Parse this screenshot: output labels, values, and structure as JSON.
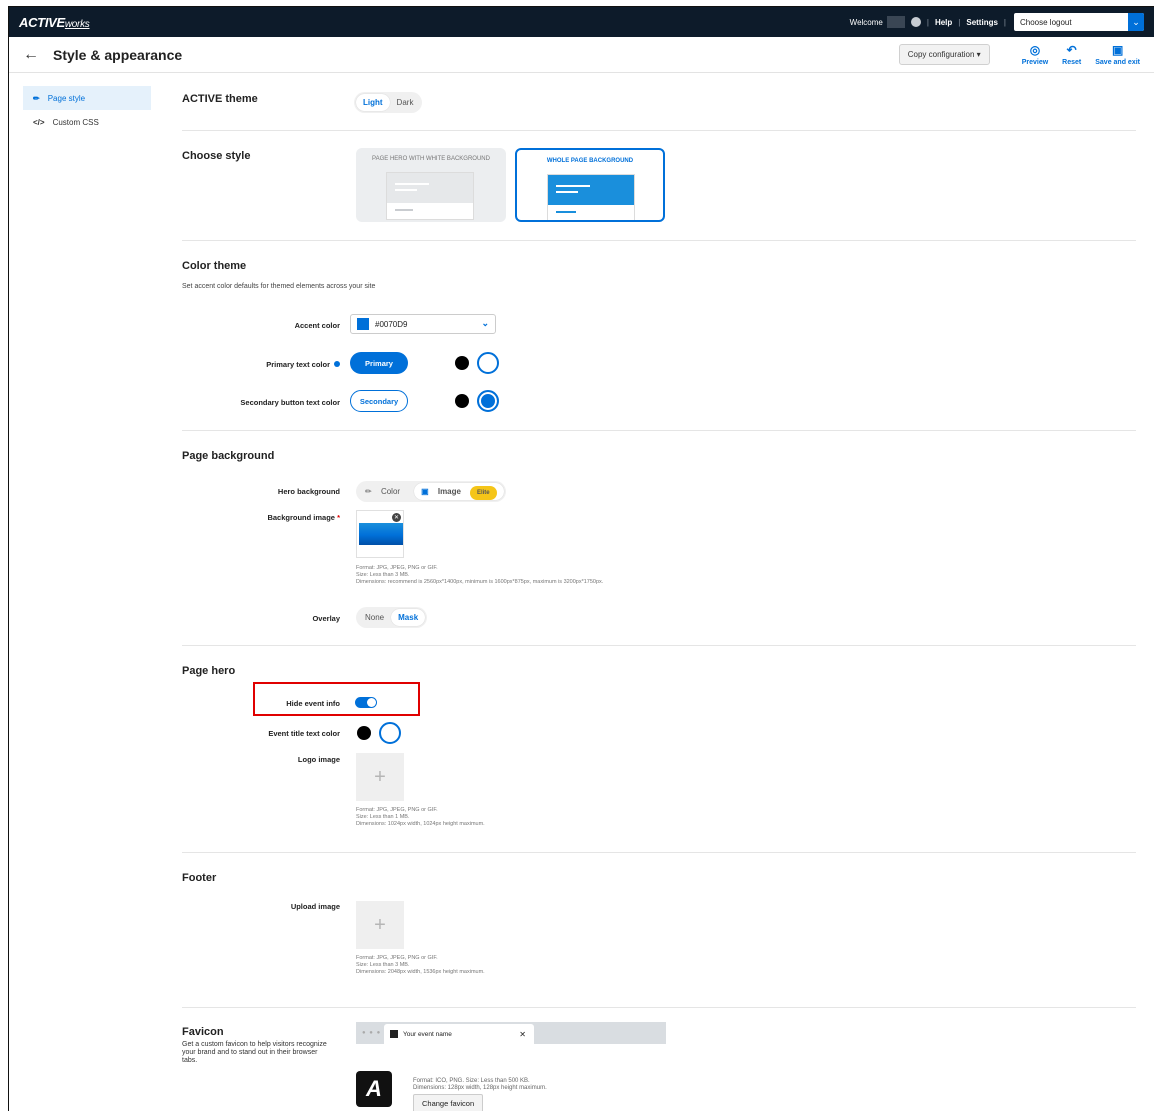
{
  "topbar": {
    "logo_main": "ACTIVE",
    "logo_sub": "works",
    "welcome": "Welcome",
    "help": "Help",
    "settings": "Settings",
    "logout_select": "Choose logout"
  },
  "header": {
    "title": "Style & appearance",
    "copy_config": "Copy configuration",
    "preview": "Preview",
    "reset": "Reset",
    "save_exit": "Save and exit"
  },
  "sidebar": {
    "items": [
      {
        "label": "Page style",
        "icon": "pencil-icon"
      },
      {
        "label": "Custom CSS",
        "icon": "code-icon"
      }
    ]
  },
  "theme": {
    "title": "ACTIVE theme",
    "options": [
      "Light",
      "Dark"
    ],
    "selected": "Light"
  },
  "style": {
    "title": "Choose style",
    "cards": [
      "PAGE HERO WITH WHITE BACKGROUND",
      "WHOLE PAGE BACKGROUND"
    ],
    "selected": "WHOLE PAGE BACKGROUND"
  },
  "color_theme": {
    "title": "Color theme",
    "desc": "Set accent color defaults for themed elements across your site",
    "accent_label": "Accent color",
    "accent_value": "#0070D9",
    "primary_label": "Primary text color",
    "primary_btn": "Primary",
    "secondary_label": "Secondary button text color",
    "secondary_btn": "Secondary"
  },
  "background": {
    "title": "Page background",
    "hero_label": "Hero background",
    "hero_options": [
      "Color",
      "Image"
    ],
    "elite": "Elite",
    "image_label": "Background image",
    "required": "*",
    "fine1": "Format: JPG, JPEG, PNG or GIF.",
    "fine2": "Size: Less than 3 MB.",
    "fine3": "Dimensions: recommend is 2560px*1400px, minimum is 1600px*875px, maximum is 3200px*1750px.",
    "overlay_label": "Overlay",
    "overlay_options": [
      "None",
      "Mask"
    ]
  },
  "hero": {
    "title": "Page hero",
    "hide_label": "Hide event info",
    "hide_value": true,
    "title_color_label": "Event title text color",
    "logo_label": "Logo image",
    "fine1": "Format: JPG, JPEG, PNG or GIF.",
    "fine2": "Size: Less than 1 MB.",
    "fine3": "Dimensions: 1024px width, 1024px height maximum."
  },
  "footer": {
    "title": "Footer",
    "upload_label": "Upload image",
    "fine1": "Format: JPG, JPEG, PNG or GIF.",
    "fine2": "Size: Less than 3 MB.",
    "fine3": "Dimensions: 2048px width, 1536px height maximum."
  },
  "favicon": {
    "title": "Favicon",
    "desc": "Get a custom favicon to help visitors recognize your brand and to stand out in their browser tabs.",
    "tab_name": "Your event name",
    "fine1": "Format: ICO, PNG. Size: Less than 500 KB.",
    "fine2": "Dimensions: 128px width, 128px height maximum.",
    "change_btn": "Change favicon"
  },
  "colors": {
    "accent": "#0070d9",
    "topbar": "#0d1b2a",
    "highlight": "#e00000"
  }
}
